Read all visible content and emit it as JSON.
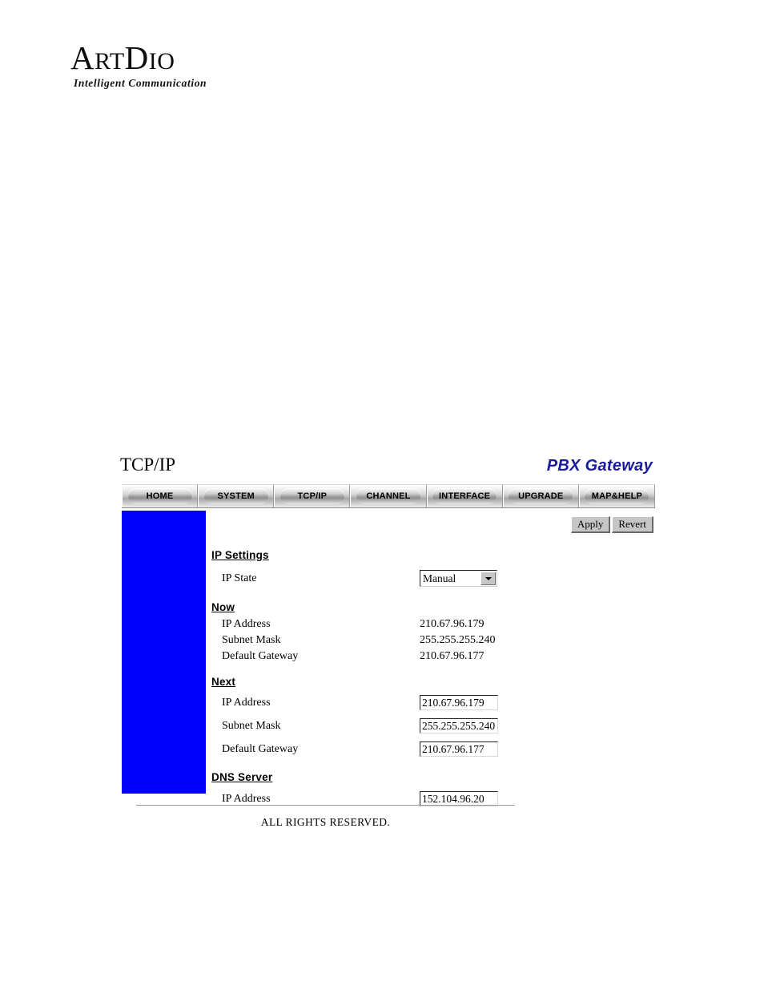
{
  "logo": {
    "word_part1_cap": "A",
    "word_part1_rest": "RT",
    "word_part2_cap": "D",
    "word_part2_rest": "IO",
    "tagline": "Intelligent Communication"
  },
  "header": {
    "page_title": "TCP/IP",
    "brand_title": "PBX Gateway",
    "brand_color": "#1a1a9c"
  },
  "nav": {
    "items": [
      {
        "label": "HOME"
      },
      {
        "label": "SYSTEM"
      },
      {
        "label": "TCP/IP"
      },
      {
        "label": "CHANNEL"
      },
      {
        "label": "INTERFACE"
      },
      {
        "label": "UPGRADE"
      },
      {
        "label": "MAP&HELP"
      }
    ]
  },
  "actions": {
    "apply_label": "Apply",
    "revert_label": "Revert"
  },
  "sidebar": {
    "color": "#0000ff"
  },
  "form": {
    "ip_settings": {
      "heading": "IP Settings",
      "ip_state_label": "IP State",
      "ip_state_value": "Manual",
      "ip_state_options": [
        "Manual"
      ]
    },
    "now": {
      "heading": "Now",
      "rows": [
        {
          "label": "IP Address",
          "value": "210.67.96.179"
        },
        {
          "label": "Subnet Mask",
          "value": "255.255.255.240"
        },
        {
          "label": "Default Gateway",
          "value": "210.67.96.177"
        }
      ]
    },
    "next": {
      "heading": "Next",
      "rows": [
        {
          "label": "IP Address",
          "value": "210.67.96.179"
        },
        {
          "label": "Subnet Mask",
          "value": "255.255.255.240"
        },
        {
          "label": "Default Gateway",
          "value": "210.67.96.177"
        }
      ]
    },
    "dns": {
      "heading": "DNS Server",
      "rows": [
        {
          "label": "IP Address",
          "value": "152.104.96.20"
        }
      ]
    }
  },
  "footer": {
    "text": "ALL RIGHTS RESERVED."
  }
}
